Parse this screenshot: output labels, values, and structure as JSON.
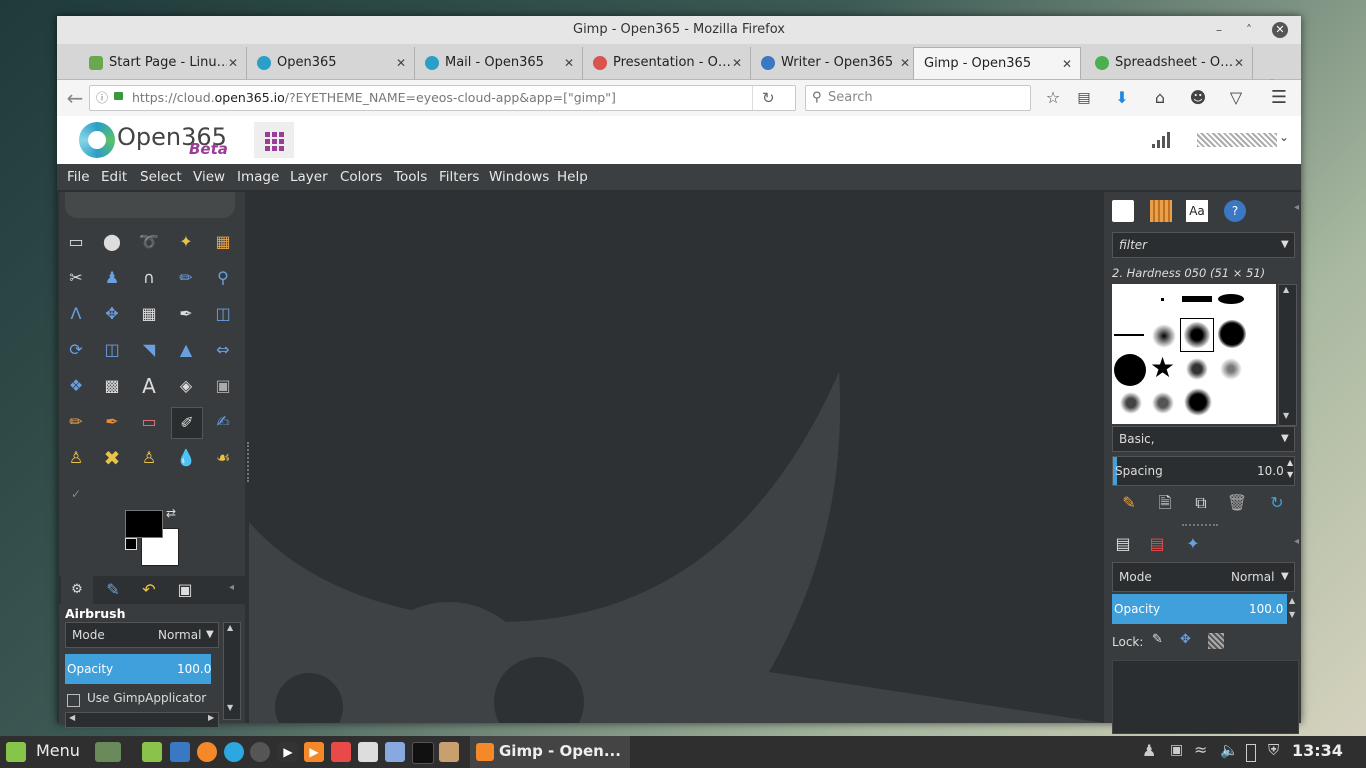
{
  "window": {
    "title": "Gimp - Open365 - Mozilla Firefox",
    "controls": {
      "minimize": "–",
      "maximize": "˄",
      "close": "✕"
    }
  },
  "tabs": [
    {
      "label": "Start Page - Linu…",
      "color": "#6aa84f",
      "active": false
    },
    {
      "label": "Open365",
      "color": "#2b9fc7",
      "active": false
    },
    {
      "label": "Mail - Open365",
      "color": "#2b9fc7",
      "active": false
    },
    {
      "label": "Presentation - O…",
      "color": "#d9534f",
      "active": false
    },
    {
      "label": "Writer - Open365",
      "color": "#3b78c4",
      "active": false
    },
    {
      "label": "Gimp - Open365",
      "color": "#f5f5f5",
      "active": true
    },
    {
      "label": "Spreadsheet - O…",
      "color": "#4caf50",
      "active": false
    }
  ],
  "tab_close": "✕",
  "new_tab": "✚",
  "nav": {
    "url_prefix": "https://cloud.",
    "url_domain": "open365.io",
    "url_suffix": "/?EYETHEME_NAME=eyeos-cloud-app&app=[\"gimp\"]",
    "search_placeholder": "Search"
  },
  "open365": {
    "brand": "Open365",
    "beta": "Beta"
  },
  "gimp": {
    "menu": [
      "File",
      "Edit",
      "Select",
      "View",
      "Image",
      "Layer",
      "Colors",
      "Tools",
      "Filters",
      "Windows",
      "Help"
    ],
    "tool_options": {
      "title": "Airbrush",
      "mode_label": "Mode",
      "mode_value": "Normal",
      "opacity_label": "Opacity",
      "opacity_value": "100.0",
      "applicator_label": "Use GimpApplicator"
    },
    "brushes": {
      "filter": "filter",
      "selected": "2. Hardness 050 (51 × 51)",
      "preset": "Basic,",
      "spacing_label": "Spacing",
      "spacing_value": "10.0",
      "tab_text": "Aa"
    },
    "layers": {
      "mode_label": "Mode",
      "mode_value": "Normal",
      "opacity_label": "Opacity",
      "opacity_value": "100.0",
      "lock_label": "Lock:"
    }
  },
  "taskbar": {
    "menu_label": "Menu",
    "active_window": "Gimp - Open...",
    "clock": "13:34"
  }
}
